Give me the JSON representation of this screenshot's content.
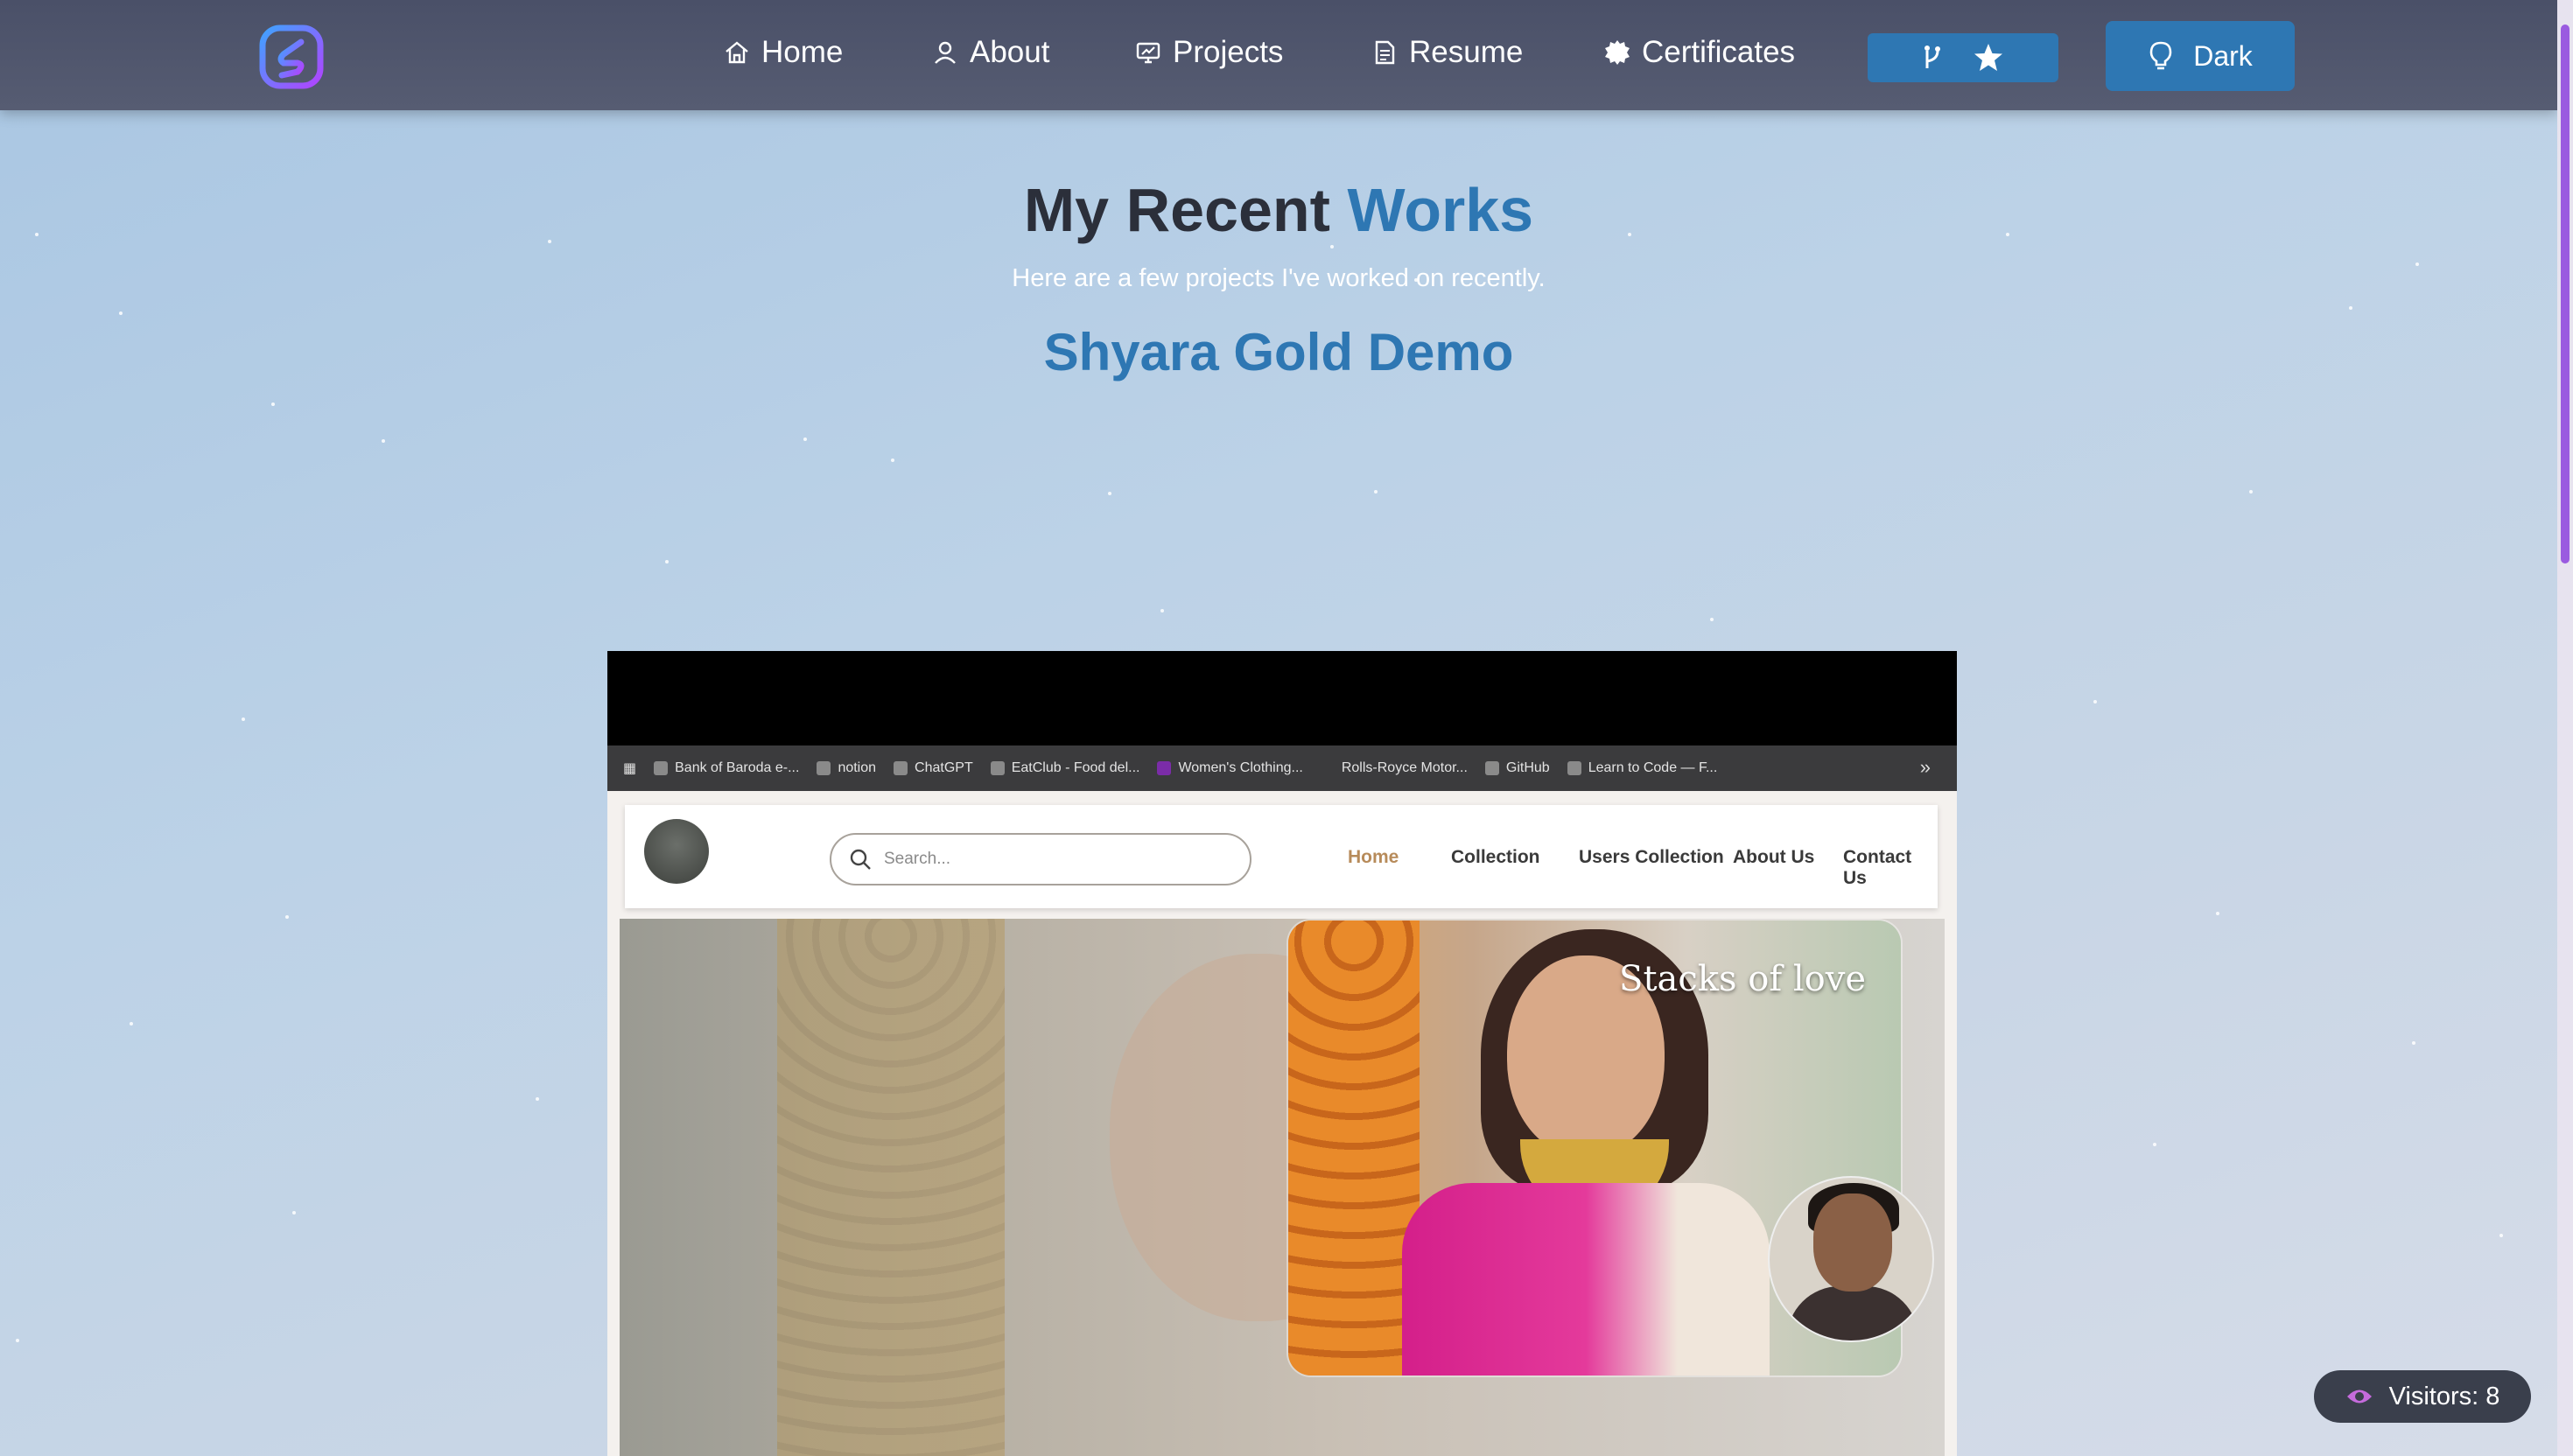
{
  "nav": {
    "items": [
      {
        "label": "Home",
        "icon": "home-icon"
      },
      {
        "label": "About",
        "icon": "user-icon"
      },
      {
        "label": "Projects",
        "icon": "projects-icon"
      },
      {
        "label": "Resume",
        "icon": "document-icon"
      },
      {
        "label": "Certificates",
        "icon": "badge-icon"
      }
    ],
    "theme_button_label": "Dark",
    "fork_star_icons": [
      "fork-icon",
      "star-icon"
    ]
  },
  "section": {
    "title_plain": "My Recent ",
    "title_accent": "Works",
    "subtitle": "Here are a few projects I've worked on recently.",
    "project_title": "Shyara Gold Demo"
  },
  "preview": {
    "bookmarks": [
      "Bank of Baroda e-...",
      "notion",
      "ChatGPT",
      "EatClub - Food del...",
      "Women's Clothing...",
      "Rolls-Royce Motor...",
      "GitHub",
      "Learn to Code — F..."
    ],
    "bookmarks_more": "»",
    "search_placeholder": "Search...",
    "site_links": [
      "Home",
      "Collection",
      "Users Collection",
      "About Us",
      "Contact Us"
    ],
    "hero_text": "Stacks of love"
  },
  "visitors": {
    "label": "Visitors: 8"
  },
  "colors": {
    "accent": "#2e77b3",
    "navbar": "#4f556b",
    "scroll_thumb": "#9a5be0"
  }
}
